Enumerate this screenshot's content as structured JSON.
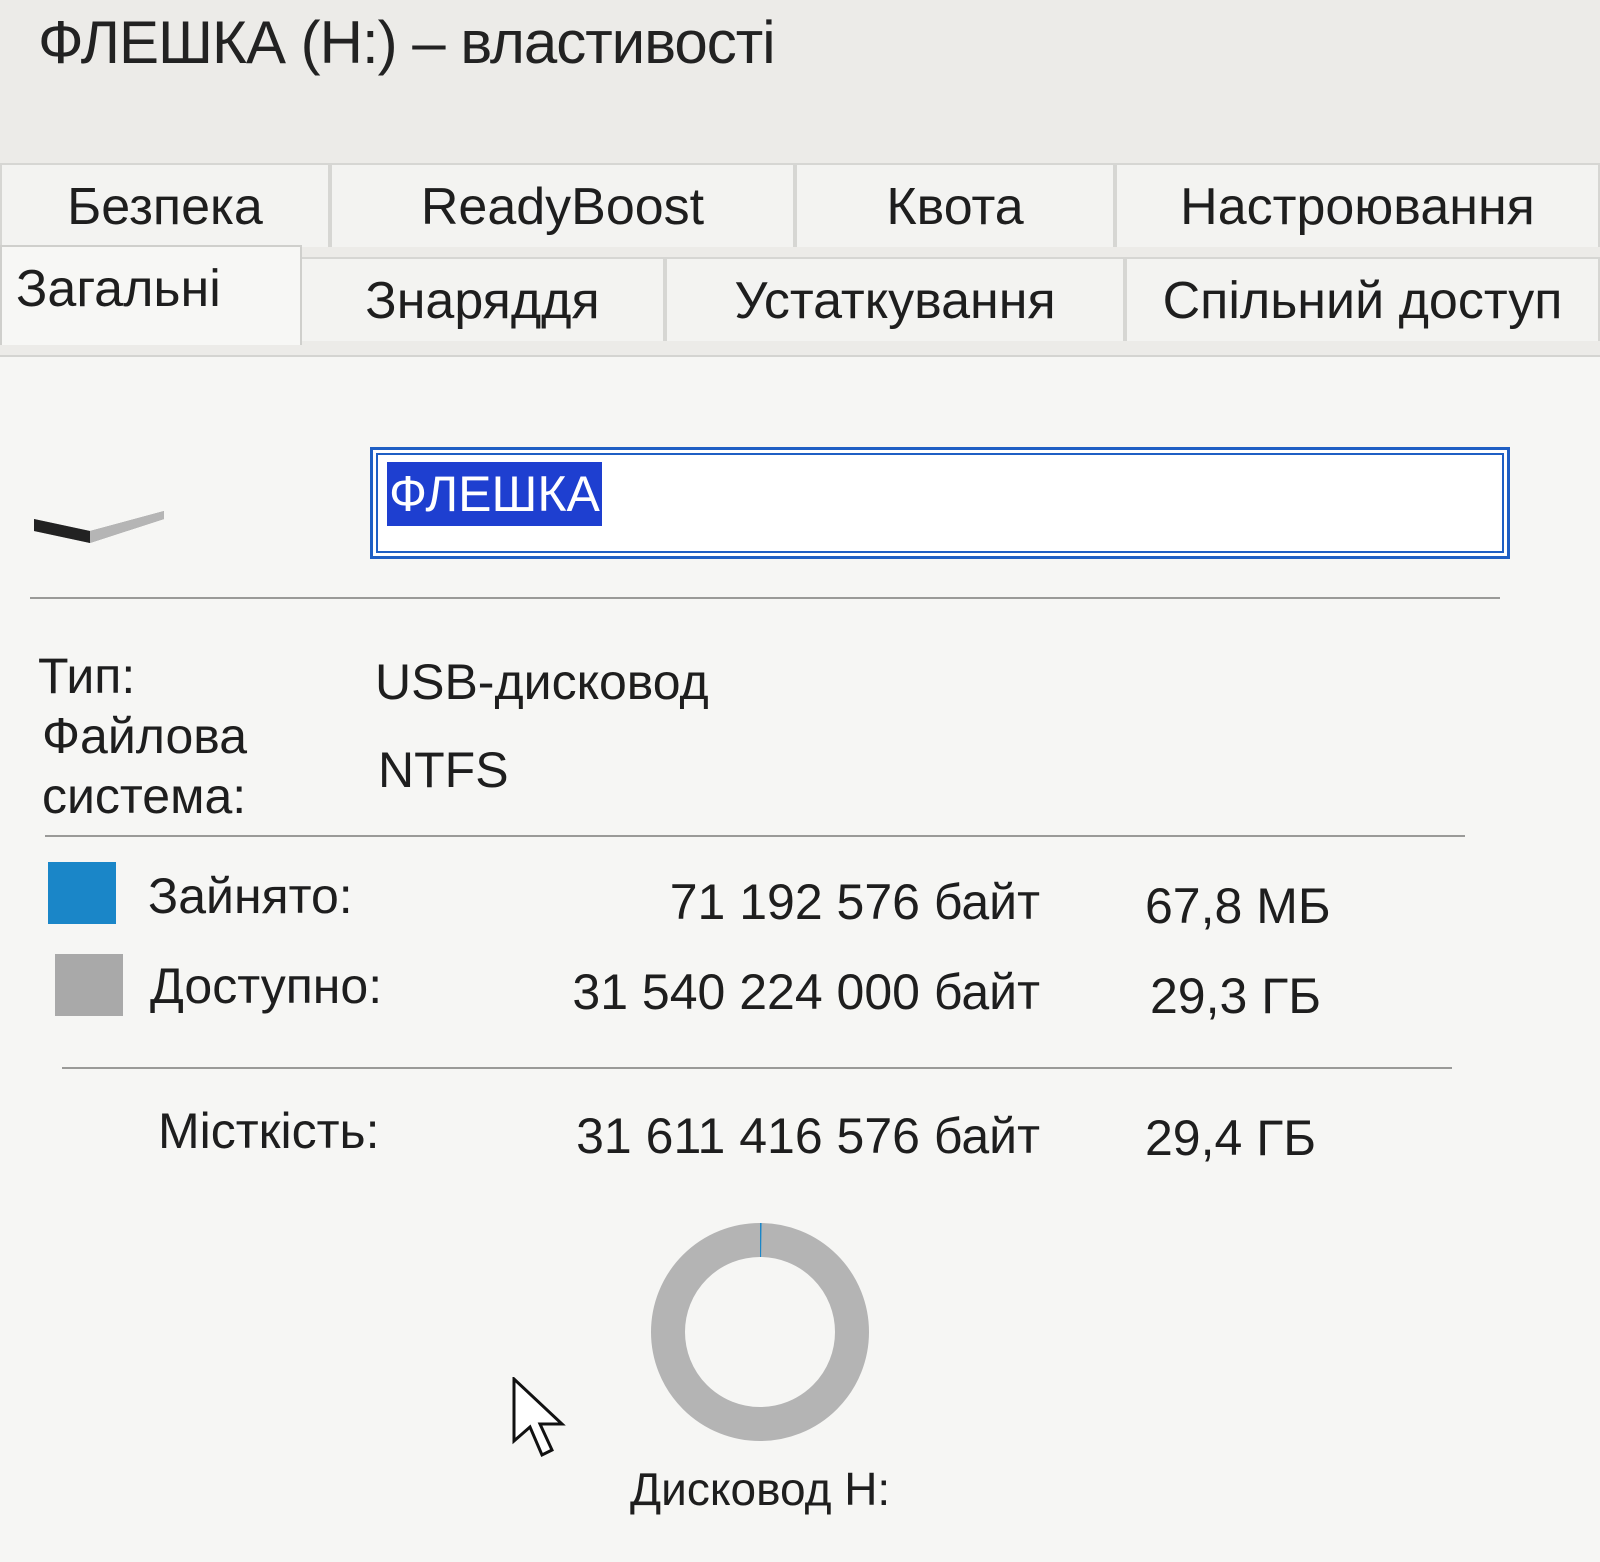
{
  "window": {
    "title": "ФЛЕШКА (H:) – властивості"
  },
  "tabs": {
    "row1": [
      "Безпека",
      "ReadyBoost",
      "Квота",
      "Настроювання"
    ],
    "row2": [
      "Загальні",
      "Знаряддя",
      "Устаткування",
      "Спільний доступ"
    ]
  },
  "general": {
    "volume_name": "ФЛЕШКА",
    "type_label": "Тип:",
    "type_value": "USB-дисковод",
    "fs_label_1": "Файлова",
    "fs_label_2": "система:",
    "fs_value": "NTFS",
    "used_label": "Зайнято:",
    "used_bytes": "71 192 576 байт",
    "used_human": "67,8 МБ",
    "free_label": "Доступно:",
    "free_bytes": "31 540 224 000 байт",
    "free_human": "29,3 ГБ",
    "capacity_label": "Місткість:",
    "capacity_bytes": "31 611 416 576 байт",
    "capacity_human": "29,4 ГБ",
    "drive_caption": "Дисковод H:",
    "used_fraction": 0.0023
  },
  "colors": {
    "used": "#1a86c8",
    "free": "#a9a9a9",
    "selection": "#1e3fd0",
    "input_border": "#1f5fc4"
  },
  "icons": [
    "usb-drive-icon",
    "mouse-cursor-icon"
  ]
}
